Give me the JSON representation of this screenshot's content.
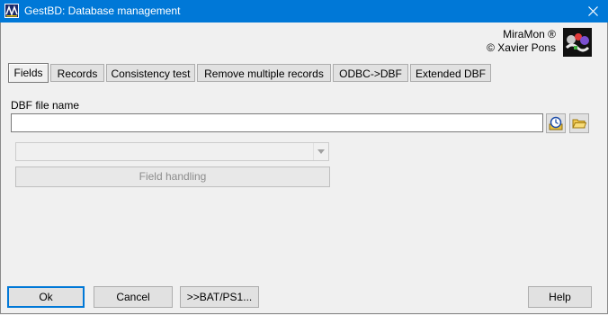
{
  "window": {
    "title": "GestBD: Database management",
    "icon": "gestbd-app-icon",
    "close_glyph": "×"
  },
  "brand": {
    "line1": "MiraMon ®",
    "line2": "© Xavier Pons",
    "logo": "miramon-logo"
  },
  "tabs": [
    {
      "label": "Fields",
      "active": true
    },
    {
      "label": "Records",
      "active": false
    },
    {
      "label": "Consistency test",
      "active": false
    },
    {
      "label": "Remove multiple records",
      "active": false
    },
    {
      "label": "ODBC->DBF",
      "active": false
    },
    {
      "label": "Extended DBF",
      "active": false
    }
  ],
  "dbf_file": {
    "label": "DBF file name",
    "value": "",
    "history_icon": "history-clock-icon",
    "browse_icon": "open-folder-icon"
  },
  "field_combo": {
    "value": ""
  },
  "field_handling_button": {
    "label": "Field handling"
  },
  "footer": {
    "ok_label": "Ok",
    "cancel_label": "Cancel",
    "bat_label": ">>BAT/PS1...",
    "help_label": "Help"
  },
  "colors": {
    "titlebar": "#0078d7",
    "window_bg": "#f0f0f0",
    "button_bg": "#e1e1e1"
  }
}
